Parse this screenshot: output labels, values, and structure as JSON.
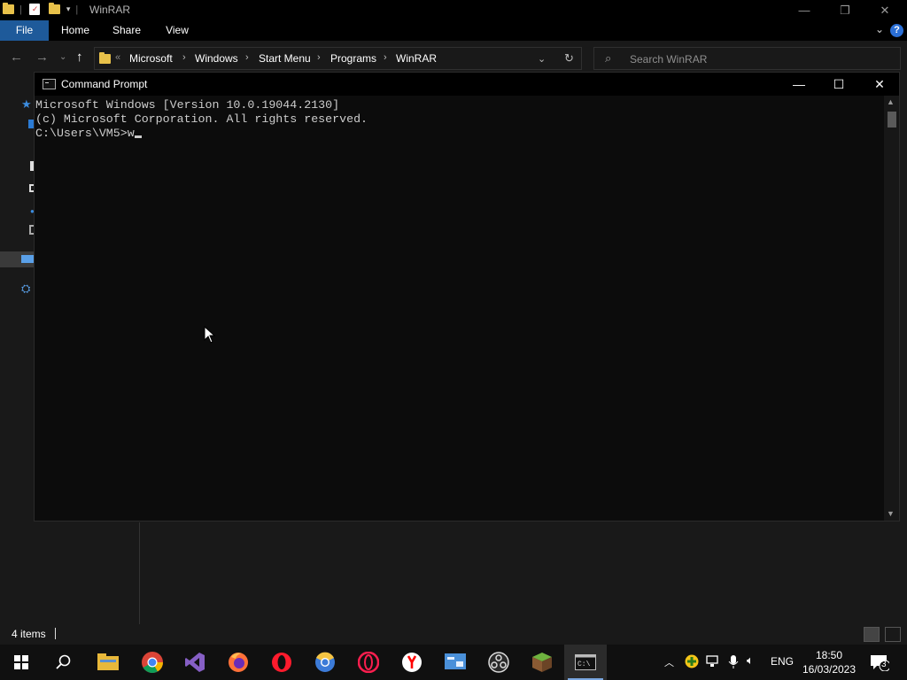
{
  "explorer": {
    "title": "WinRAR",
    "ribbon_tabs": [
      "File",
      "Home",
      "Share",
      "View"
    ],
    "breadcrumb": [
      "Microsoft",
      "Windows",
      "Start Menu",
      "Programs",
      "WinRAR"
    ],
    "search_placeholder": "Search WinRAR",
    "status_items": "4 items"
  },
  "cmd": {
    "title": "Command Prompt",
    "lines": [
      "Microsoft Windows [Version 10.0.19044.2130]",
      "(c) Microsoft Corporation. All rights reserved.",
      "",
      "C:\\Users\\VM5>w"
    ]
  },
  "taskbar": {
    "apps": [
      "start-icon",
      "search-icon",
      "file-explorer-icon",
      "chrome-icon",
      "visual-studio-icon",
      "firefox-icon",
      "opera-icon",
      "chromium-icon",
      "opera-gx-icon",
      "yandex-icon",
      "control-panel-icon",
      "obs-icon",
      "minecraft-icon",
      "command-prompt-icon"
    ],
    "language": "ENG",
    "time": "18:50",
    "date": "16/03/2023",
    "notification_count": "3"
  },
  "colors": {
    "accent": "#1e5a9a",
    "console_text": "#cccccc",
    "folder": "#e8c14a"
  }
}
